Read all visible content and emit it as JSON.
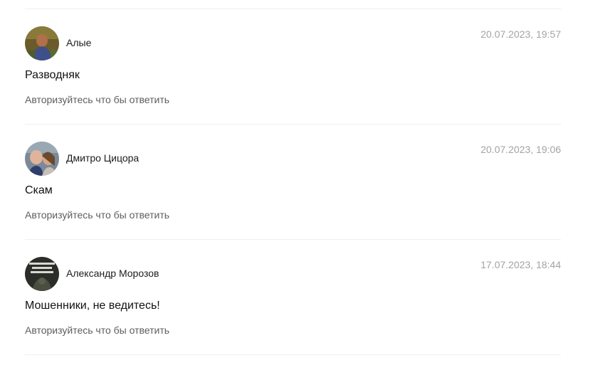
{
  "comments": [
    {
      "author": "Алые",
      "date": "20.07.2023, 19:57",
      "text": "Разводняк",
      "reply_link": "Авторизуйтесь что бы ответить"
    },
    {
      "author": "Дмитро Цицора",
      "date": "20.07.2023, 19:06",
      "text": "Скам",
      "reply_link": "Авторизуйтесь что бы ответить"
    },
    {
      "author": "Александр Морозов",
      "date": "17.07.2023, 18:44",
      "text": "Мошенники, не ведитесь!",
      "reply_link": "Авторизуйтесь что бы ответить"
    }
  ]
}
